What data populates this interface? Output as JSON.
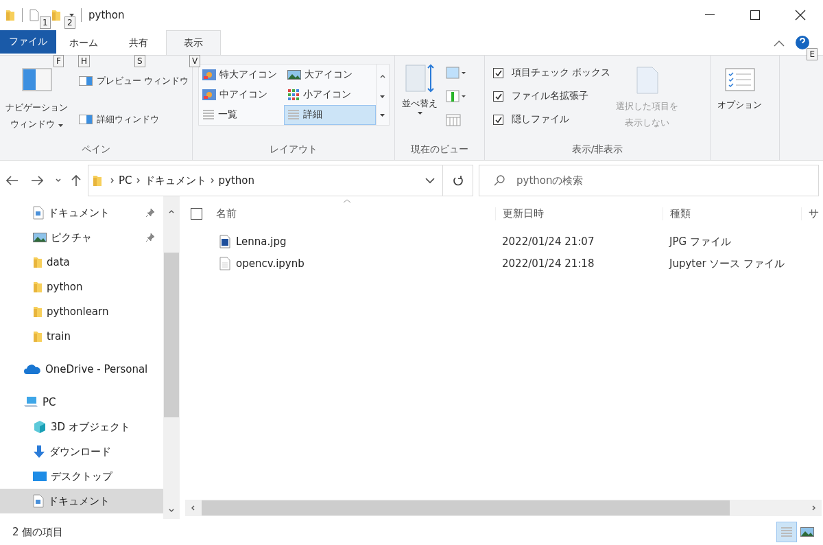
{
  "title_bar": {
    "title": "python",
    "quick_access_keys": [
      "1",
      "2"
    ],
    "help_key": "E"
  },
  "ribbon_tabs": [
    {
      "label": "ファイル",
      "key_tip": "F",
      "kind": "file",
      "selected": false
    },
    {
      "label": "ホーム",
      "key_tip": "H",
      "kind": "tab",
      "selected": false
    },
    {
      "label": "共有",
      "key_tip": "S",
      "kind": "tab",
      "selected": false
    },
    {
      "label": "表示",
      "key_tip": "V",
      "kind": "tab",
      "selected": true
    }
  ],
  "ribbon": {
    "pane": {
      "label": "ペイン",
      "navigation_button": [
        "ナビゲーション",
        "ウィンドウ"
      ],
      "buttons": [
        "プレビュー ウィンドウ",
        "詳細ウィンドウ"
      ]
    },
    "layout": {
      "label": "レイアウト",
      "items": [
        {
          "label": "特大アイコン",
          "kind": "xl",
          "selected": false
        },
        {
          "label": "大アイコン",
          "kind": "large",
          "selected": false
        },
        {
          "label": "中アイコン",
          "kind": "medium",
          "selected": false
        },
        {
          "label": "小アイコン",
          "kind": "small",
          "selected": false
        },
        {
          "label": "一覧",
          "kind": "list",
          "selected": false
        },
        {
          "label": "詳細",
          "kind": "details",
          "selected": true
        }
      ]
    },
    "current_view": {
      "label": "現在のビュー",
      "sort_button": "並べ替え"
    },
    "show_hide": {
      "label": "表示/非表示",
      "checkboxes": [
        {
          "label": "項目チェック ボックス",
          "checked": true
        },
        {
          "label": "ファイル名拡張子",
          "checked": true
        },
        {
          "label": "隠しファイル",
          "checked": true
        }
      ],
      "hide_button": {
        "lines": [
          "選択した項目を",
          "表示しない"
        ],
        "disabled": true
      }
    },
    "options": {
      "label": "オプション"
    }
  },
  "address_bar": {
    "breadcrumb": [
      "PC",
      "ドキュメント",
      "python"
    ],
    "search_placeholder": "pythonの検索"
  },
  "sidebar": {
    "quick_access_items": [
      {
        "label": "ドキュメント",
        "kind": "document",
        "pinned": true,
        "selected": false
      },
      {
        "label": "ピクチャ",
        "kind": "picture",
        "pinned": true,
        "selected": false
      },
      {
        "label": "data",
        "kind": "folder",
        "pinned": false,
        "selected": false
      },
      {
        "label": "python",
        "kind": "folder",
        "pinned": false,
        "selected": false
      },
      {
        "label": "pythonlearn",
        "kind": "folder",
        "pinned": false,
        "selected": false
      },
      {
        "label": "train",
        "kind": "folder",
        "pinned": false,
        "selected": false
      }
    ],
    "roots": [
      {
        "label": "OneDrive - Personal",
        "kind": "cloud",
        "selected": false
      },
      {
        "label": "PC",
        "kind": "pc",
        "selected": false,
        "children": [
          {
            "label": "3D オブジェクト",
            "kind": "cube",
            "selected": false
          },
          {
            "label": "ダウンロード",
            "kind": "download",
            "selected": false
          },
          {
            "label": "デスクトップ",
            "kind": "desktop",
            "selected": false
          },
          {
            "label": "ドキュメント",
            "kind": "document",
            "selected": true
          }
        ]
      }
    ]
  },
  "file_list": {
    "select_all_checked": false,
    "columns": [
      "名前",
      "更新日時",
      "種類",
      "サ"
    ],
    "rows": [
      {
        "name": "Lenna.jpg",
        "kind": "image",
        "modified": "2022/01/24 21:07",
        "type": "JPG ファイル"
      },
      {
        "name": "opencv.ipynb",
        "kind": "document",
        "modified": "2022/01/24 21:18",
        "type": "Jupyter ソース ファイル"
      }
    ]
  },
  "status_bar": {
    "item_count": "2 個の項目",
    "views": [
      {
        "kind": "details",
        "selected": true
      },
      {
        "kind": "large",
        "selected": false
      }
    ]
  }
}
